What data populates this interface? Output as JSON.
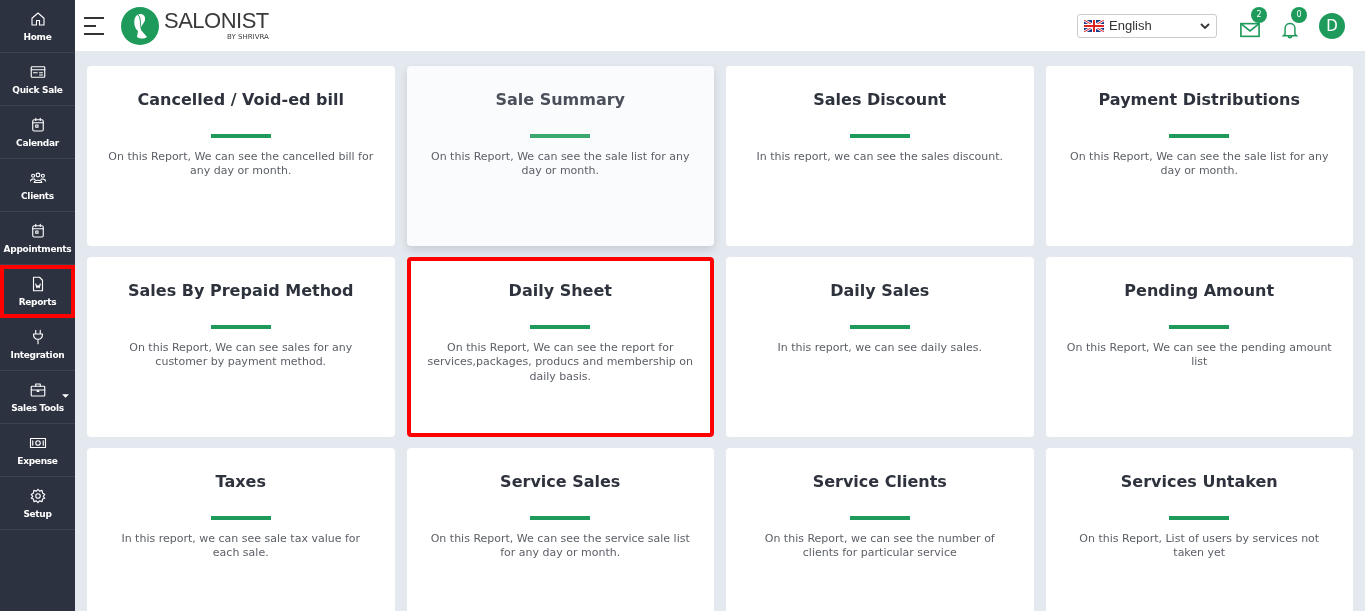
{
  "sidebar": {
    "items": [
      {
        "label": "Home",
        "kind": "home",
        "highlighted": false,
        "has_caret": false
      },
      {
        "label": "Quick Sale",
        "kind": "register",
        "highlighted": false,
        "has_caret": false
      },
      {
        "label": "Calendar",
        "kind": "calendar",
        "highlighted": false,
        "has_caret": false
      },
      {
        "label": "Clients",
        "kind": "people",
        "highlighted": false,
        "has_caret": false
      },
      {
        "label": "Appointments",
        "kind": "calendar",
        "highlighted": false,
        "has_caret": false
      },
      {
        "label": "Reports",
        "kind": "document",
        "highlighted": true,
        "has_caret": false
      },
      {
        "label": "Integration",
        "kind": "plug",
        "highlighted": false,
        "has_caret": false
      },
      {
        "label": "Sales Tools",
        "kind": "briefcase",
        "highlighted": false,
        "has_caret": true
      },
      {
        "label": "Expense",
        "kind": "cash",
        "highlighted": false,
        "has_caret": false
      },
      {
        "label": "Setup",
        "kind": "gear",
        "highlighted": false,
        "has_caret": false
      }
    ]
  },
  "header": {
    "logo": {
      "name": "SALONIST",
      "tagline": "BY SHRIVRA"
    },
    "language": {
      "value": "English"
    },
    "mail_badge": "2",
    "notification_badge": "0",
    "avatar": "D"
  },
  "cards": [
    {
      "title": "Cancelled / Void-ed bill",
      "description": "On this Report, We can see the cancelled bill for any day or month.",
      "hovered": false,
      "highlighted": false
    },
    {
      "title": "Sale Summary",
      "description": "On this Report, We can see the sale list for any day or month.",
      "hovered": true,
      "highlighted": false
    },
    {
      "title": "Sales Discount",
      "description": "In this report, we can see the sales discount.",
      "hovered": false,
      "highlighted": false
    },
    {
      "title": "Payment Distributions",
      "description": "On this Report, We can see the sale list for any day or month.",
      "hovered": false,
      "highlighted": false
    },
    {
      "title": "Sales By Prepaid Method",
      "description": "On this Report, We can see sales for any customer by payment method.",
      "hovered": false,
      "highlighted": false
    },
    {
      "title": "Daily Sheet",
      "description": "On this Report, We can see the report for services,packages, producs and membership on daily basis.",
      "hovered": false,
      "highlighted": true
    },
    {
      "title": "Daily Sales",
      "description": "In this report, we can see daily sales.",
      "hovered": false,
      "highlighted": false
    },
    {
      "title": "Pending Amount",
      "description": "On this Report, We can see the pending amount list",
      "hovered": false,
      "highlighted": false
    },
    {
      "title": "Taxes",
      "description": "In this report, we can see sale tax value for each sale.",
      "hovered": false,
      "highlighted": false
    },
    {
      "title": "Service Sales",
      "description": "On this Report, We can see the service sale list for any day or month.",
      "hovered": false,
      "highlighted": false
    },
    {
      "title": "Service Clients",
      "description": "On this Report, we can see the number of clients for particular service",
      "hovered": false,
      "highlighted": false
    },
    {
      "title": "Services Untaken",
      "description": "On this Report, List of users by services not taken yet",
      "hovered": false,
      "highlighted": false
    }
  ]
}
